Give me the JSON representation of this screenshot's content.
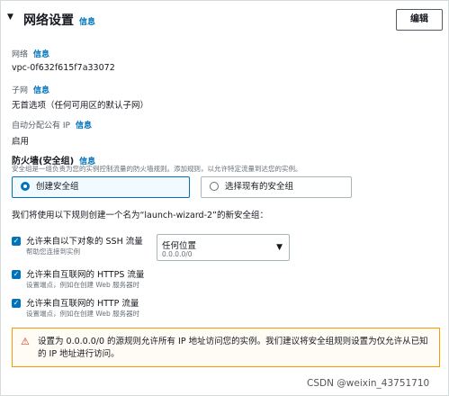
{
  "header": {
    "collapse_icon": "caret-down-icon",
    "title": "网络设置",
    "info_label": "信息",
    "edit_label": "编辑"
  },
  "network": {
    "label": "网络",
    "info_label": "信息",
    "value": "vpc-0f632f615f7a33072"
  },
  "subnet": {
    "label": "子网",
    "info_label": "信息",
    "value": "无首选项（任何可用区的默认子网）"
  },
  "public_ip": {
    "label": "自动分配公有 IP",
    "info_label": "信息",
    "value": "启用"
  },
  "firewall": {
    "title": "防火墙(安全组)",
    "info_label": "信息",
    "description": "安全组是一组负责为您的实例控制流量的防火墙规则。添加规则，以允许特定流量到达您的实例。",
    "options": [
      {
        "label": "创建安全组",
        "selected": true
      },
      {
        "label": "选择现有的安全组",
        "selected": false
      }
    ],
    "rule_intro": "我们将使用以下规则创建一个名为“launch-wizard-2”的新安全组："
  },
  "rules": {
    "ssh": {
      "label": "允许来自以下对象的 SSH 流量",
      "sub": "帮助您连接到实例",
      "checked": true,
      "source_value": "任何位置",
      "source_cidr": "0.0.0.0/0"
    },
    "https": {
      "label": "允许来自互联网的 HTTPS 流量",
      "sub": "设置端点，例如在创建 Web 服务器时",
      "checked": true
    },
    "http": {
      "label": "允许来自互联网的 HTTP 流量",
      "sub": "设置端点，例如在创建 Web 服务器时",
      "checked": true
    }
  },
  "warning": {
    "icon": "warning-icon",
    "text": "设置为 0.0.0.0/0 的源规则允许所有 IP 地址访问您的实例。我们建议将安全组规则设置为仅允许从已知的 IP 地址进行访问。"
  },
  "watermark": "CSDN @weixin_43751710",
  "colors": {
    "accent": "#0073bb",
    "warning_border": "#ff9900",
    "warning_icon": "#d13212"
  }
}
